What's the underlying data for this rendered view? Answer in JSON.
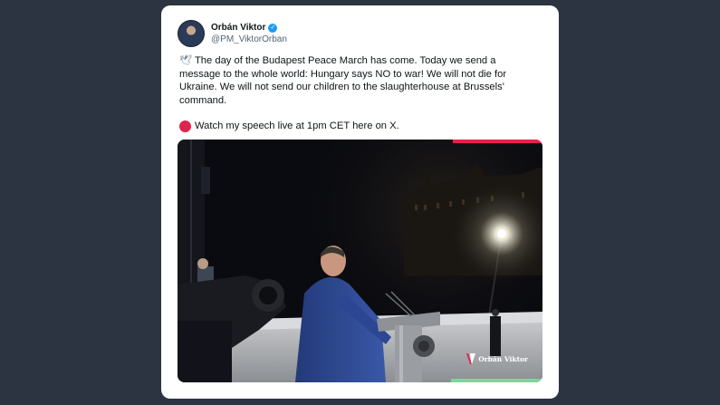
{
  "tweet": {
    "author": {
      "name": "Orbán Viktor",
      "handle": "@PM_ViktorOrban"
    },
    "paragraph1": "The day of the Budapest Peace March has come. Today we send a message to the whole world: Hungary says NO to war! We will not die for Ukraine. We will not send our children to the slaughterhouse at Brussels' command.",
    "paragraph2": "Watch my speech live at 1pm CET here on X.",
    "icons": {
      "paragraph1": "dove-icon",
      "paragraph2": "red-circle-icon",
      "verified": "verified-badge-icon"
    },
    "photo_watermark": "Orbán Viktor"
  },
  "colors": {
    "background": "#2b3440",
    "card": "#ffffff",
    "verified": "#1d9bf0",
    "red_dot": "#e0244b",
    "photo_top_bar": "#e0244b",
    "photo_bottom_bar": "#7fd49a"
  }
}
